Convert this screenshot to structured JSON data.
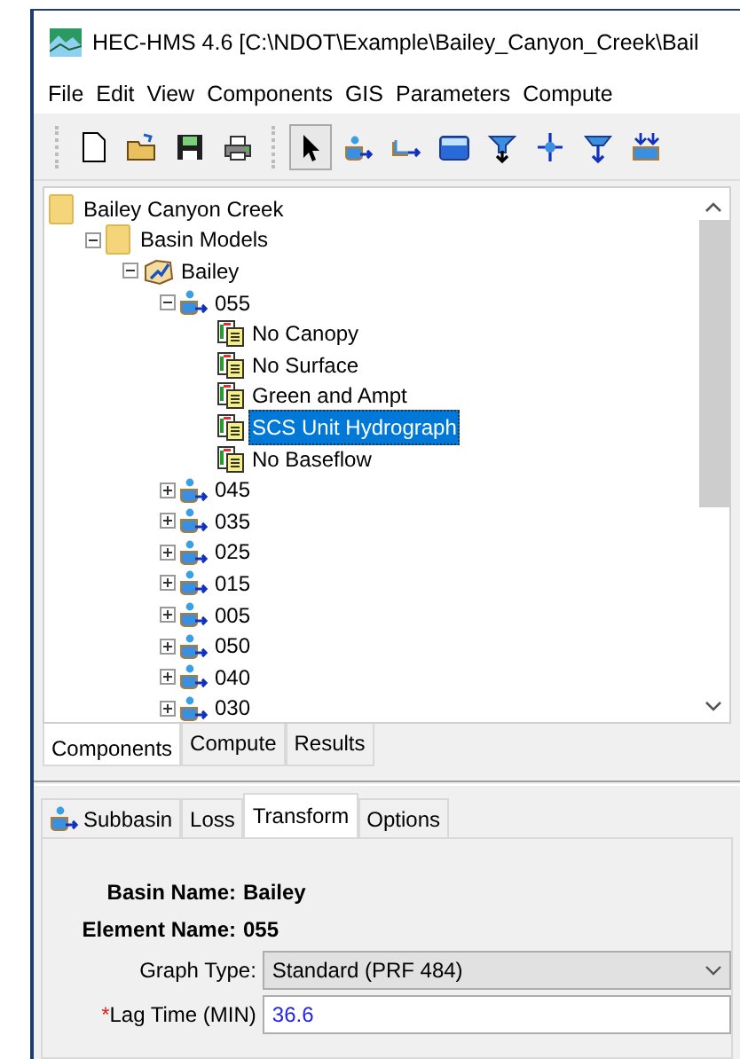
{
  "window": {
    "title": "HEC-HMS 4.6 [C:\\NDOT\\Example\\Bailey_Canyon_Creek\\Bail"
  },
  "menu": [
    "File",
    "Edit",
    "View",
    "Components",
    "GIS",
    "Parameters",
    "Compute"
  ],
  "toolbar": [
    {
      "kind": "new",
      "selected": false
    },
    {
      "kind": "open",
      "selected": false
    },
    {
      "kind": "save",
      "selected": false
    },
    {
      "kind": "print",
      "selected": false
    },
    {
      "kind": "pointer",
      "selected": true
    },
    {
      "kind": "subbasin",
      "selected": false
    },
    {
      "kind": "reach",
      "selected": false
    },
    {
      "kind": "reservoir",
      "selected": false
    },
    {
      "kind": "source",
      "selected": false
    },
    {
      "kind": "junction",
      "selected": false
    },
    {
      "kind": "diversion",
      "selected": false
    },
    {
      "kind": "sink",
      "selected": false
    }
  ],
  "tree": [
    {
      "label": "Bailey Canyon Creek",
      "kind": "folder",
      "selected": false,
      "children": [
        {
          "label": "Basin Models",
          "kind": "folder",
          "selected": false,
          "expanded": true,
          "children": [
            {
              "label": "Bailey",
              "kind": "basin",
              "selected": false,
              "expanded": true,
              "children": [
                {
                  "label": "055",
                  "kind": "subbasin",
                  "selected": false,
                  "expanded": true,
                  "children": [
                    {
                      "label": "No Canopy",
                      "kind": "method",
                      "selected": false
                    },
                    {
                      "label": "No Surface",
                      "kind": "method",
                      "selected": false
                    },
                    {
                      "label": "Green and Ampt",
                      "kind": "method",
                      "selected": false
                    },
                    {
                      "label": "SCS Unit Hydrograph",
                      "kind": "method",
                      "selected": true
                    },
                    {
                      "label": "No Baseflow",
                      "kind": "method",
                      "selected": false
                    }
                  ]
                },
                {
                  "label": "045",
                  "kind": "subbasin",
                  "selected": false,
                  "expanded": false
                },
                {
                  "label": "035",
                  "kind": "subbasin",
                  "selected": false,
                  "expanded": false
                },
                {
                  "label": "025",
                  "kind": "subbasin",
                  "selected": false,
                  "expanded": false
                },
                {
                  "label": "015",
                  "kind": "subbasin",
                  "selected": false,
                  "expanded": false
                },
                {
                  "label": "005",
                  "kind": "subbasin",
                  "selected": false,
                  "expanded": false
                },
                {
                  "label": "050",
                  "kind": "subbasin",
                  "selected": false,
                  "expanded": false
                },
                {
                  "label": "040",
                  "kind": "subbasin",
                  "selected": false,
                  "expanded": false
                },
                {
                  "label": "030",
                  "kind": "subbasin",
                  "selected": false,
                  "expanded": false
                }
              ]
            }
          ]
        }
      ]
    }
  ],
  "panel_tabs": [
    {
      "label": "Components",
      "selected": true
    },
    {
      "label": "Compute",
      "selected": false
    },
    {
      "label": "Results",
      "selected": false
    }
  ],
  "editor_tabs": [
    {
      "label": "Subbasin",
      "kind": "subbasin",
      "selected": false
    },
    {
      "label": "Loss",
      "selected": false
    },
    {
      "label": "Transform",
      "selected": true
    },
    {
      "label": "Options",
      "selected": false
    }
  ],
  "editor": {
    "basin_label": "Basin Name:",
    "basin_value": "Bailey",
    "element_label": "Element Name:",
    "element_value": "055",
    "fields": [
      {
        "kind": "select",
        "label": "Graph Type:",
        "value": "Standard (PRF 484)"
      },
      {
        "kind": "input",
        "label": "Lag Time (MIN)",
        "required": true,
        "required_mark": "*",
        "value": "36.6"
      }
    ]
  }
}
